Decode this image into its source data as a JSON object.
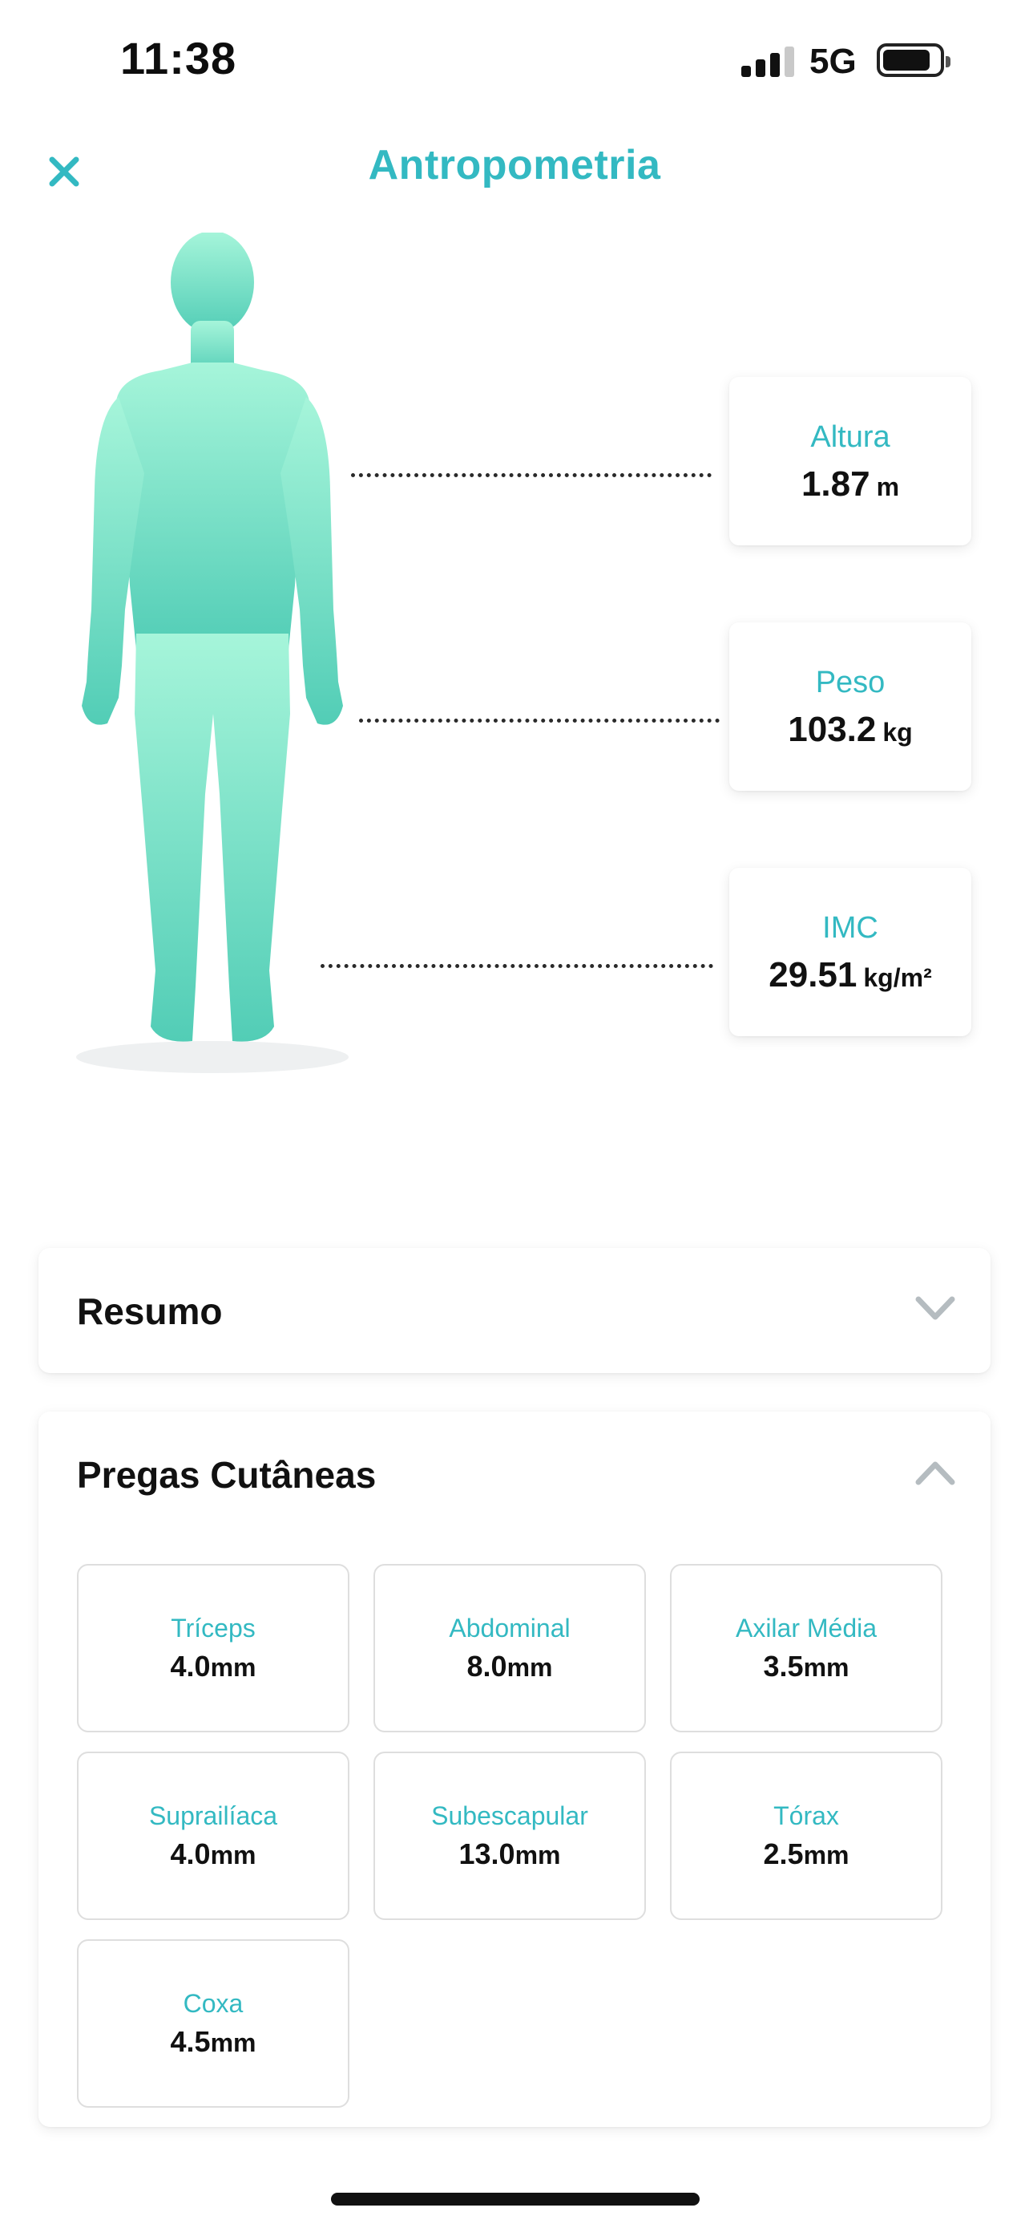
{
  "status_bar": {
    "time": "11:38",
    "network": "5G",
    "signal_bars": 3,
    "signal_bars_total": 4
  },
  "header": {
    "title": "Antropometria",
    "close_icon": "close-icon"
  },
  "metrics": [
    {
      "label": "Altura",
      "value": "1.87",
      "unit": "m"
    },
    {
      "label": "Peso",
      "value": "103.2",
      "unit": "kg"
    },
    {
      "label": "IMC",
      "value": "29.51",
      "unit": "kg/m²"
    }
  ],
  "summary": {
    "title": "Resumo",
    "expanded": false
  },
  "skinfolds": {
    "title": "Pregas Cutâneas",
    "expanded": true,
    "items": [
      {
        "label": "Tríceps",
        "value": "4.0",
        "unit": "mm"
      },
      {
        "label": "Abdominal",
        "value": "8.0",
        "unit": "mm"
      },
      {
        "label": "Axilar Média",
        "value": "3.5",
        "unit": "mm"
      },
      {
        "label": "Suprailíaca",
        "value": "4.0",
        "unit": "mm"
      },
      {
        "label": "Subescapular",
        "value": "13.0",
        "unit": "mm"
      },
      {
        "label": "Tórax",
        "value": "2.5",
        "unit": "mm"
      },
      {
        "label": "Coxa",
        "value": "4.5",
        "unit": "mm"
      }
    ]
  },
  "colors": {
    "accent": "#33b9c2",
    "figure_top": "#a6f5da",
    "figure_bottom": "#52cdb6",
    "chevron": "#b5bcc0"
  }
}
